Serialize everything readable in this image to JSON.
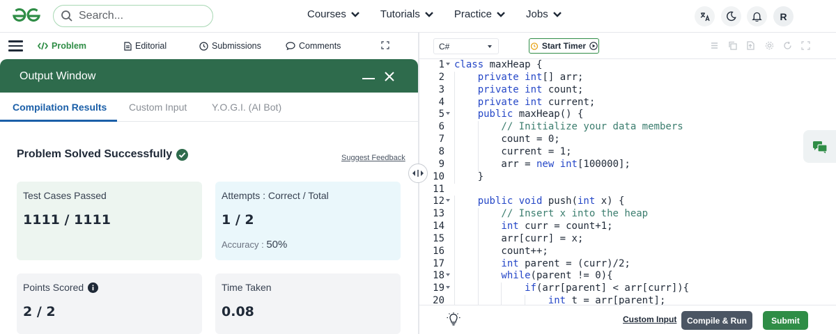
{
  "header": {
    "search_placeholder": "Search...",
    "nav": [
      {
        "label": "Courses"
      },
      {
        "label": "Tutorials"
      },
      {
        "label": "Practice"
      },
      {
        "label": "Jobs"
      }
    ],
    "avatar_letter": "R",
    "brand_color": "#2f8d46"
  },
  "problem_tabs": {
    "problem": "Problem",
    "editorial": "Editorial",
    "submissions": "Submissions",
    "comments": "Comments"
  },
  "output_window": {
    "title": "Output Window",
    "tabs": [
      "Compilation Results",
      "Custom Input",
      "Y.O.G.I. (AI Bot)"
    ],
    "result_title": "Problem Solved Successfully",
    "suggest_feedback": "Suggest Feedback",
    "cards": {
      "tests_label": "Test Cases Passed",
      "tests_value": "1111 / 1111",
      "attempts_label": "Attempts : Correct / Total",
      "attempts_value": "1 / 2",
      "accuracy_label": "Accuracy :",
      "accuracy_value": "50%",
      "points_label": "Points Scored",
      "points_value": "2 / 2",
      "time_label": "Time Taken",
      "time_value": "0.08"
    }
  },
  "editor": {
    "language": "C#",
    "timer_label": "Start Timer",
    "lines": [
      {
        "n": "1",
        "fold": true,
        "indent": 0,
        "tokens": [
          [
            "kw",
            "class"
          ],
          [
            "t",
            " maxHeap {"
          ]
        ]
      },
      {
        "n": "2",
        "fold": false,
        "indent": 1,
        "tokens": [
          [
            "kw",
            "private"
          ],
          [
            "t",
            " "
          ],
          [
            "kw",
            "int"
          ],
          [
            "t",
            "[] arr;"
          ]
        ]
      },
      {
        "n": "3",
        "fold": false,
        "indent": 1,
        "tokens": [
          [
            "kw",
            "private"
          ],
          [
            "t",
            " "
          ],
          [
            "kw",
            "int"
          ],
          [
            "t",
            " count;"
          ]
        ]
      },
      {
        "n": "4",
        "fold": false,
        "indent": 1,
        "tokens": [
          [
            "kw",
            "private"
          ],
          [
            "t",
            " "
          ],
          [
            "kw",
            "int"
          ],
          [
            "t",
            " current;"
          ]
        ]
      },
      {
        "n": "5",
        "fold": true,
        "indent": 1,
        "tokens": [
          [
            "kw",
            "public"
          ],
          [
            "t",
            " maxHeap() {"
          ]
        ]
      },
      {
        "n": "6",
        "fold": false,
        "indent": 2,
        "tokens": [
          [
            "cm",
            "// Initialize your data members"
          ]
        ]
      },
      {
        "n": "7",
        "fold": false,
        "indent": 2,
        "tokens": [
          [
            "t",
            "count = "
          ],
          [
            "t",
            "0"
          ],
          [
            "t",
            ";"
          ]
        ]
      },
      {
        "n": "8",
        "fold": false,
        "indent": 2,
        "tokens": [
          [
            "t",
            "current = "
          ],
          [
            "t",
            "1"
          ],
          [
            "t",
            ";"
          ]
        ]
      },
      {
        "n": "9",
        "fold": false,
        "indent": 2,
        "tokens": [
          [
            "t",
            "arr = "
          ],
          [
            "kw",
            "new"
          ],
          [
            "t",
            " "
          ],
          [
            "kw",
            "int"
          ],
          [
            "t",
            "[100000];"
          ]
        ]
      },
      {
        "n": "10",
        "fold": false,
        "indent": 1,
        "tokens": [
          [
            "t",
            "}"
          ]
        ]
      },
      {
        "n": "11",
        "fold": false,
        "indent": 0,
        "tokens": []
      },
      {
        "n": "12",
        "fold": true,
        "indent": 1,
        "tokens": [
          [
            "kw",
            "public"
          ],
          [
            "t",
            " "
          ],
          [
            "kw",
            "void"
          ],
          [
            "t",
            " push("
          ],
          [
            "kw",
            "int"
          ],
          [
            "t",
            " x) {"
          ]
        ]
      },
      {
        "n": "13",
        "fold": false,
        "indent": 2,
        "tokens": [
          [
            "cm",
            "// Insert x into the heap"
          ]
        ]
      },
      {
        "n": "14",
        "fold": false,
        "indent": 2,
        "tokens": [
          [
            "kw",
            "int"
          ],
          [
            "t",
            " curr = count+1;"
          ]
        ]
      },
      {
        "n": "15",
        "fold": false,
        "indent": 2,
        "tokens": [
          [
            "t",
            "arr[curr] = x;"
          ]
        ]
      },
      {
        "n": "16",
        "fold": false,
        "indent": 2,
        "tokens": [
          [
            "t",
            "count++;"
          ]
        ]
      },
      {
        "n": "17",
        "fold": false,
        "indent": 2,
        "tokens": [
          [
            "kw",
            "int"
          ],
          [
            "t",
            " parent = (curr)/2;"
          ]
        ]
      },
      {
        "n": "18",
        "fold": true,
        "indent": 2,
        "tokens": [
          [
            "kw",
            "while"
          ],
          [
            "t",
            "(parent != 0){"
          ]
        ]
      },
      {
        "n": "19",
        "fold": true,
        "indent": 3,
        "tokens": [
          [
            "kw",
            "if"
          ],
          [
            "t",
            "(arr[parent] < arr[curr]){"
          ]
        ]
      },
      {
        "n": "20",
        "fold": false,
        "indent": 4,
        "tokens": [
          [
            "kw",
            "int"
          ],
          [
            "t",
            " t = arr[parent];"
          ]
        ]
      }
    ],
    "custom_input": "Custom Input",
    "compile_run": "Compile & Run",
    "submit": "Submit"
  }
}
